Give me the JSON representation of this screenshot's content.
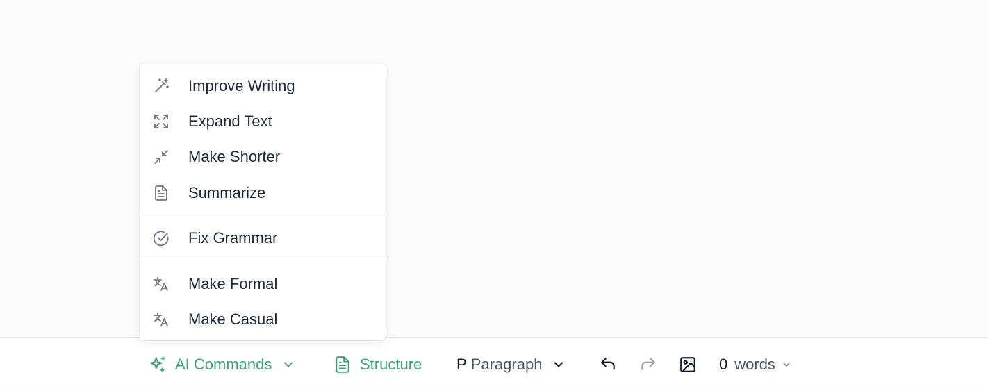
{
  "ai_menu": {
    "items": [
      {
        "label": "Improve Writing",
        "icon": "magic-wand-icon"
      },
      {
        "label": "Expand Text",
        "icon": "expand-icon"
      },
      {
        "label": "Make Shorter",
        "icon": "shrink-icon"
      },
      {
        "label": "Summarize",
        "icon": "document-icon"
      },
      {
        "label": "Fix Grammar",
        "icon": "check-circle-icon"
      },
      {
        "label": "Make Formal",
        "icon": "translate-icon"
      },
      {
        "label": "Make Casual",
        "icon": "translate-icon"
      }
    ]
  },
  "toolbar": {
    "ai_commands_label": "AI Commands",
    "structure_label": "Structure",
    "block_type_prefix": "P",
    "block_type_label": "Paragraph",
    "word_count": "0",
    "word_count_label": "words"
  },
  "colors": {
    "accent_green": "#3fa37a",
    "text_primary": "#1f2937",
    "icon_grey": "#6b7280",
    "disabled": "#9ca3af",
    "border": "#e5e7eb"
  }
}
